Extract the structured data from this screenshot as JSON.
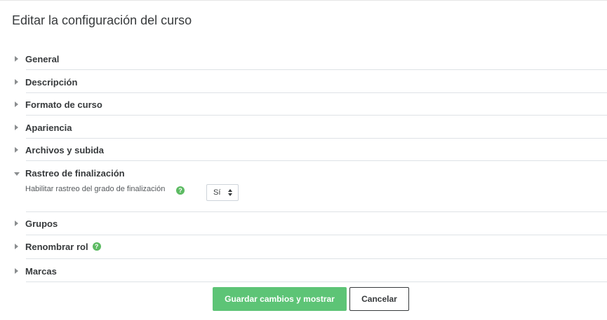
{
  "page": {
    "title": "Editar la configuración del curso"
  },
  "sections": [
    {
      "title": "General",
      "expanded": false
    },
    {
      "title": "Descripción",
      "expanded": false
    },
    {
      "title": "Formato de curso",
      "expanded": false
    },
    {
      "title": "Apariencia",
      "expanded": false
    },
    {
      "title": "Archivos y subida",
      "expanded": false
    },
    {
      "title": "Rastreo de finalización",
      "expanded": true
    },
    {
      "title": "Grupos",
      "expanded": false
    },
    {
      "title": "Renombrar rol",
      "expanded": false,
      "has_help": true
    },
    {
      "title": "Marcas",
      "expanded": false
    }
  ],
  "completion": {
    "label": "Habilitar rastreo del grado de finalización",
    "selected": "Sí",
    "help_glyph": "?"
  },
  "rename_role": {
    "help_glyph": "?"
  },
  "buttons": {
    "save": "Guardar cambios y mostrar",
    "cancel": "Cancelar"
  },
  "colors": {
    "accent_green": "#5dc476",
    "help_green": "#5dbb63",
    "text": "#373a3c"
  },
  "icons": {
    "collapsed": "caret-right-icon",
    "expanded": "caret-down-icon",
    "help": "question-circle-icon"
  }
}
